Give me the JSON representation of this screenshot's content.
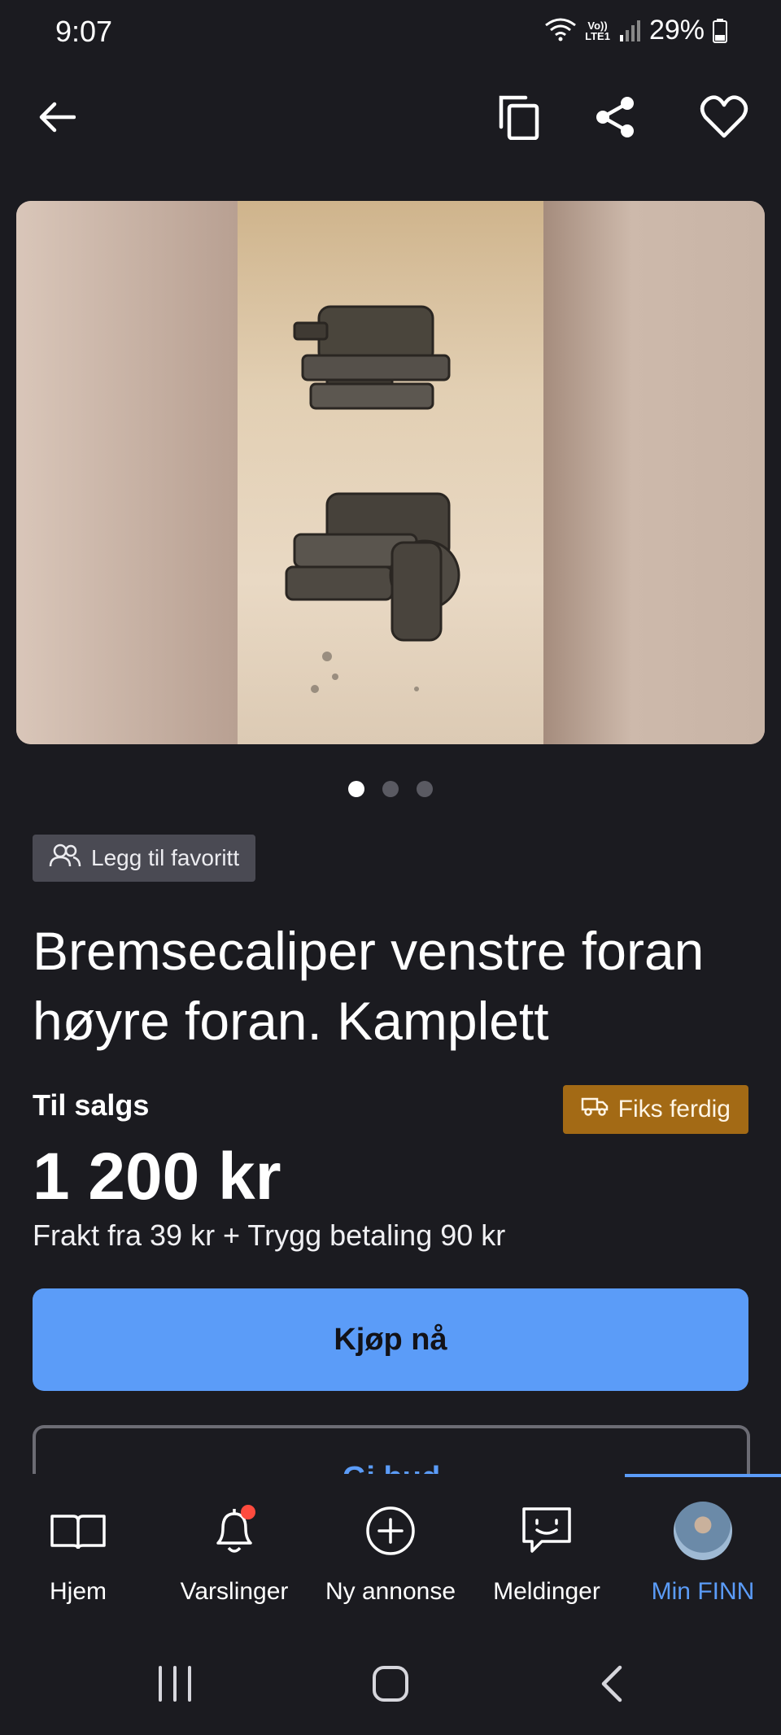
{
  "status_bar": {
    "time": "9:07",
    "network": "LTE1",
    "battery": "29%"
  },
  "app_bar": {
    "back_icon": "arrow-left-icon",
    "actions": [
      "copy-icon",
      "share-icon",
      "heart-icon"
    ]
  },
  "gallery": {
    "image_count": 3,
    "active_index": 0
  },
  "listing": {
    "favorite_chip": "Legg til favoritt",
    "title": "Bremsecaliper venstre foran høyre foran.  Kamplett",
    "status": "Til salgs",
    "badge": "Fiks ferdig",
    "price": "1 200 kr",
    "shipping": "Frakt fra 39 kr + Trygg betaling 90 kr",
    "buy_button": "Kjøp nå",
    "bid_button": "Gi bud"
  },
  "bottom_nav": {
    "items": [
      {
        "label": "Hjem",
        "icon": "book-icon"
      },
      {
        "label": "Varslinger",
        "icon": "bell-icon"
      },
      {
        "label": "Ny annonse",
        "icon": "plus-circle-icon"
      },
      {
        "label": "Meldinger",
        "icon": "chat-icon"
      },
      {
        "label": "Min FINN",
        "icon": "avatar"
      }
    ],
    "active_index": 4
  },
  "colors": {
    "background": "#1b1b20",
    "accent": "#5b9cf8",
    "badge": "#a36a15",
    "chip": "#4a4a53",
    "notification": "#ff4b3e"
  }
}
